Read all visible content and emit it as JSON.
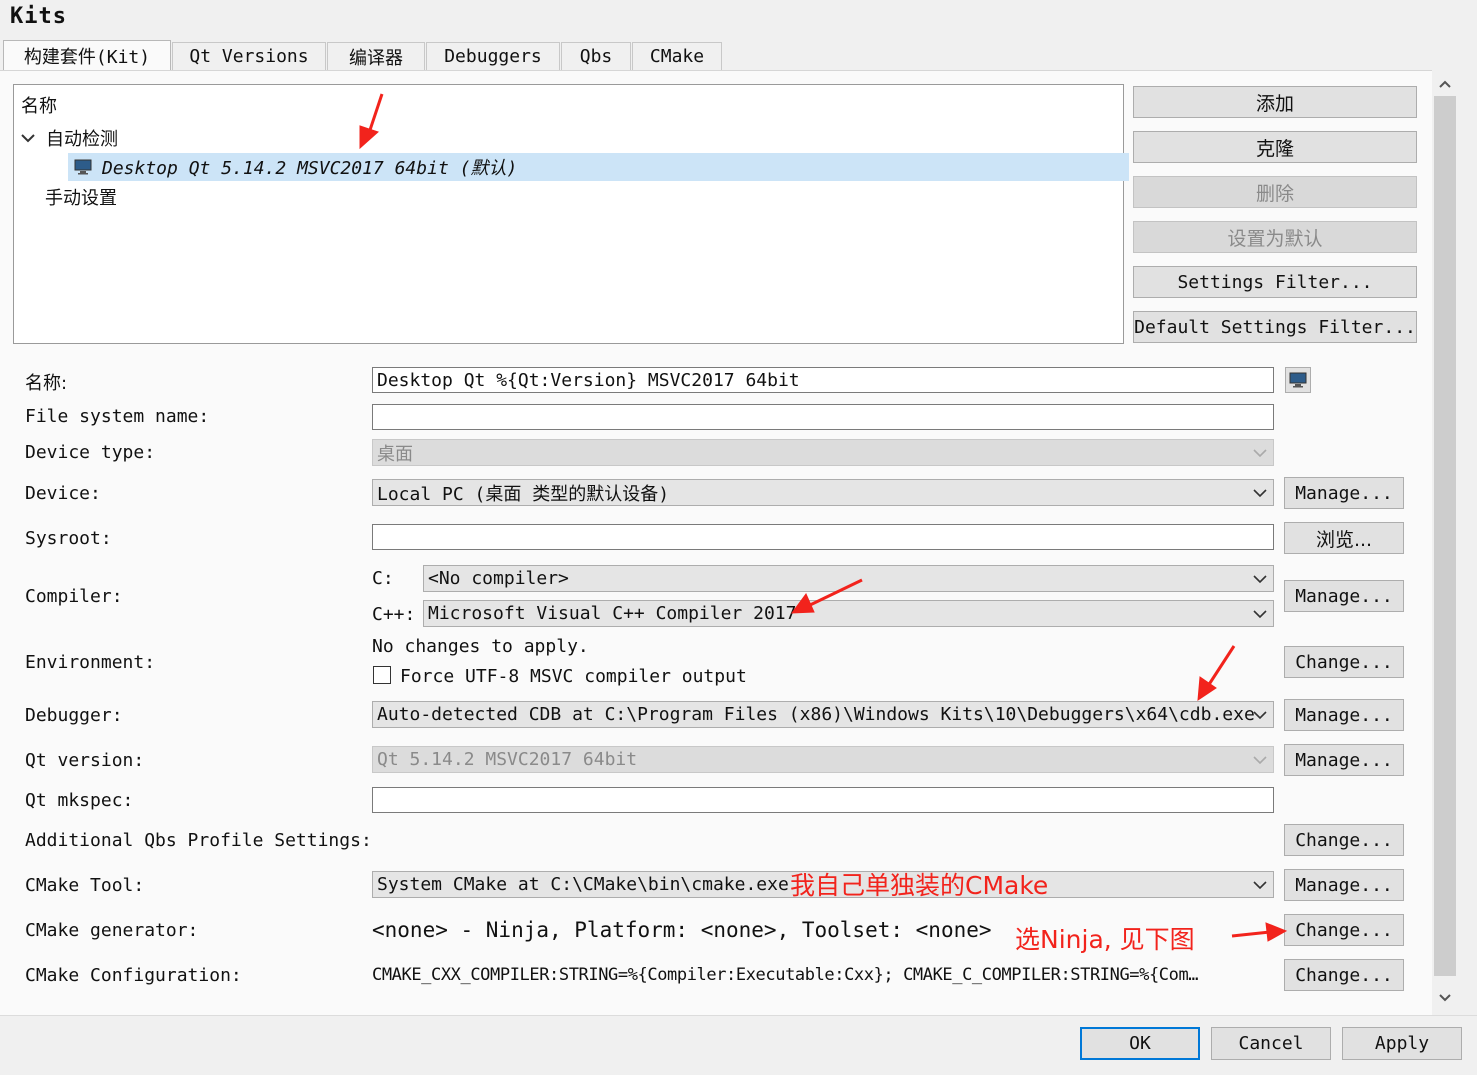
{
  "window": {
    "title": "Kits"
  },
  "tabs": [
    {
      "label": "构建套件(Kit)",
      "active": true
    },
    {
      "label": "Qt Versions"
    },
    {
      "label": "编译器"
    },
    {
      "label": "Debuggers"
    },
    {
      "label": "Qbs"
    },
    {
      "label": "CMake"
    }
  ],
  "tree": {
    "header": "名称",
    "auto_group": "自动检测",
    "selected_kit": "Desktop Qt 5.14.2 MSVC2017 64bit (默认)",
    "manual_group": "手动设置"
  },
  "side_buttons": {
    "add": "添加",
    "clone": "克隆",
    "remove": "删除",
    "make_default": "设置为默认",
    "settings_filter": "Settings Filter...",
    "default_settings_filter": "Default Settings Filter..."
  },
  "form": {
    "name_label": "名称:",
    "name_value": "Desktop Qt %{Qt:Version} MSVC2017 64bit",
    "fs_label": "File system name:",
    "fs_value": "",
    "device_type_label": "Device type:",
    "device_type_value": "桌面",
    "device_label": "Device:",
    "device_value": "Local PC (桌面 类型的默认设备)",
    "device_manage": "Manage...",
    "sysroot_label": "Sysroot:",
    "sysroot_value": "",
    "sysroot_browse": "浏览...",
    "compiler_label": "Compiler:",
    "compiler_c_label": "C:",
    "compiler_c_value": "<No compiler>",
    "compiler_cpp_label": "C++:",
    "compiler_cpp_value": "Microsoft Visual C++ Compiler 2017",
    "compiler_manage": "Manage...",
    "env_label": "Environment:",
    "env_status": "No changes to apply.",
    "env_force_utf8": "Force UTF-8 MSVC compiler output",
    "env_change": "Change...",
    "debugger_label": "Debugger:",
    "debugger_value": "Auto-detected CDB at C:\\Program Files (x86)\\Windows Kits\\10\\Debuggers\\x64\\cdb.exe",
    "debugger_manage": "Manage...",
    "qt_version_label": "Qt version:",
    "qt_version_value": "Qt 5.14.2 MSVC2017 64bit",
    "qt_version_manage": "Manage...",
    "mkspec_label": "Qt mkspec:",
    "mkspec_value": "",
    "qbs_label": "Additional Qbs Profile Settings:",
    "qbs_change": "Change...",
    "cmake_tool_label": "CMake Tool:",
    "cmake_tool_value": "System CMake at C:\\CMake\\bin\\cmake.exe",
    "cmake_tool_manage": "Manage...",
    "cmake_gen_label": "CMake generator:",
    "cmake_gen_value": "<none> - Ninja, Platform: <none>, Toolset: <none>",
    "cmake_gen_change": "Change...",
    "cmake_cfg_label": "CMake Configuration:",
    "cmake_cfg_value": "CMAKE_CXX_COMPILER:STRING=%{Compiler:Executable:Cxx}; CMAKE_C_COMPILER:STRING=%{Com…",
    "cmake_cfg_change": "Change..."
  },
  "annotations": {
    "cmake_note": "我自己单独装的CMake",
    "ninja_note": "选Ninja, 见下图",
    "color": "#f2231c"
  },
  "dialog_buttons": {
    "ok": "OK",
    "cancel": "Cancel",
    "apply": "Apply"
  }
}
